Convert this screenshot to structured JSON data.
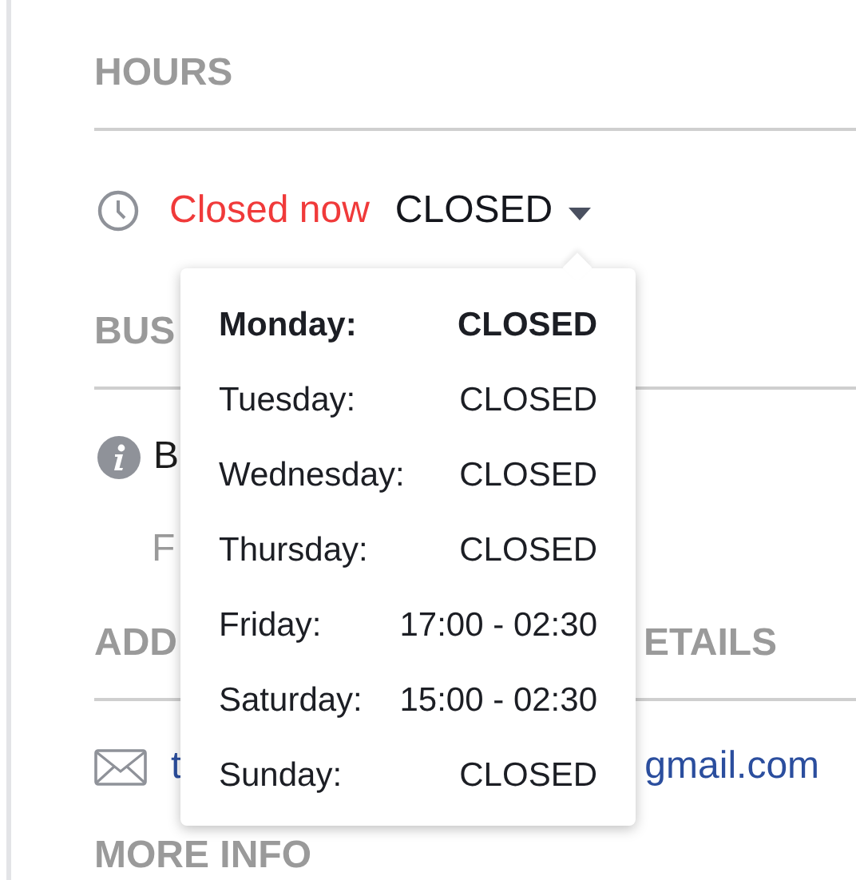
{
  "hours": {
    "heading": "HOURS",
    "status": "Closed now",
    "today": "CLOSED",
    "expanded": true,
    "days": [
      {
        "day": "Monday:",
        "hours": "CLOSED",
        "today": true
      },
      {
        "day": "Tuesday:",
        "hours": "CLOSED",
        "today": false
      },
      {
        "day": "Wednesday:",
        "hours": "CLOSED",
        "today": false
      },
      {
        "day": "Thursday:",
        "hours": "CLOSED",
        "today": false
      },
      {
        "day": "Friday:",
        "hours": "17:00 - 02:30",
        "today": false
      },
      {
        "day": "Saturday:",
        "hours": "15:00 - 02:30",
        "today": false
      },
      {
        "day": "Sunday:",
        "hours": "CLOSED",
        "today": false
      }
    ]
  },
  "business": {
    "heading": "BUS",
    "line": "B",
    "subline": "F"
  },
  "address": {
    "heading_parts": [
      "ADD",
      "ETAILS"
    ],
    "email_parts": [
      "t",
      "gmail.com"
    ]
  },
  "more_info": {
    "heading": "MORE INFO"
  }
}
